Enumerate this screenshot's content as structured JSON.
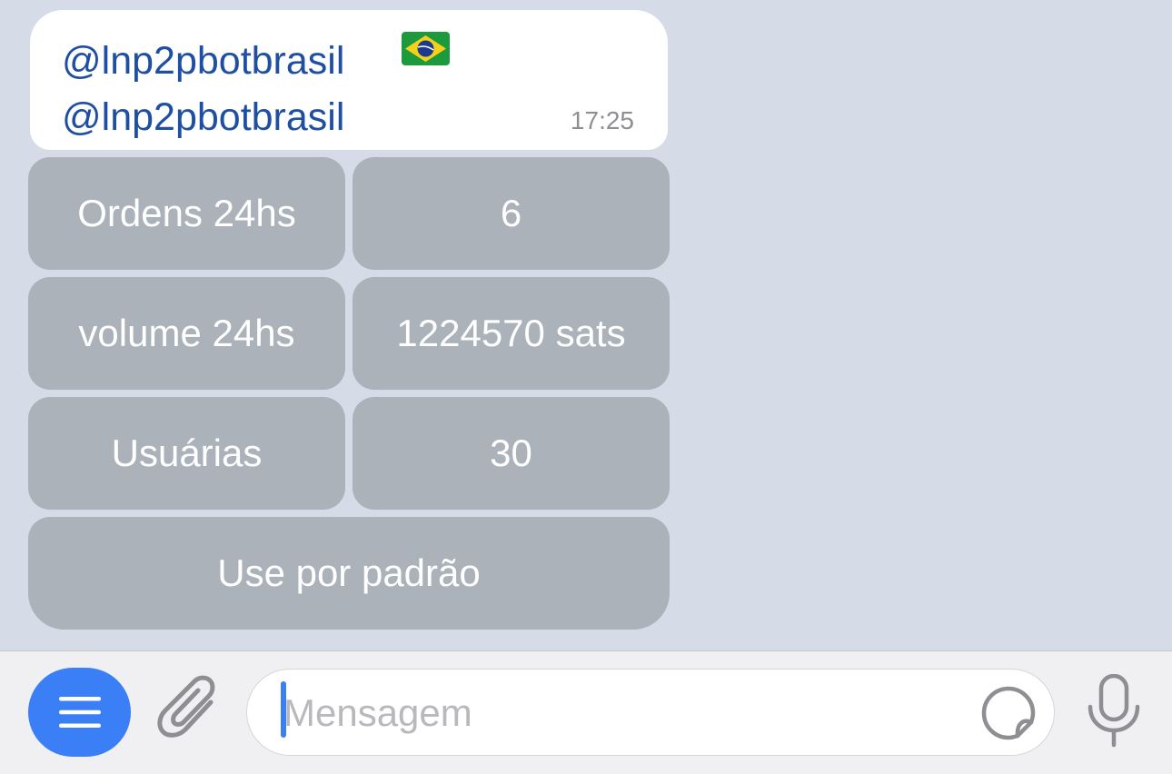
{
  "message": {
    "mention_line1": "@lnp2pbotbrasil",
    "mention_line2": "@lnp2pbotbrasil",
    "flag_emoji": "brazil-flag",
    "time": "17:25"
  },
  "keyboard": {
    "rows": [
      {
        "label": "Ordens 24hs",
        "value": "6"
      },
      {
        "label": "volume 24hs",
        "value": "1224570 sats"
      },
      {
        "label": "Usuárias",
        "value": "30"
      }
    ],
    "default_button": "Use por padrão"
  },
  "composer": {
    "placeholder": "Mensagem",
    "value": ""
  },
  "colors": {
    "background": "#d5dce7",
    "bubble": "#ffffff",
    "mention": "#1f4fa3",
    "keyboard_button": "#abb2ba",
    "accent": "#3a7ff6"
  }
}
